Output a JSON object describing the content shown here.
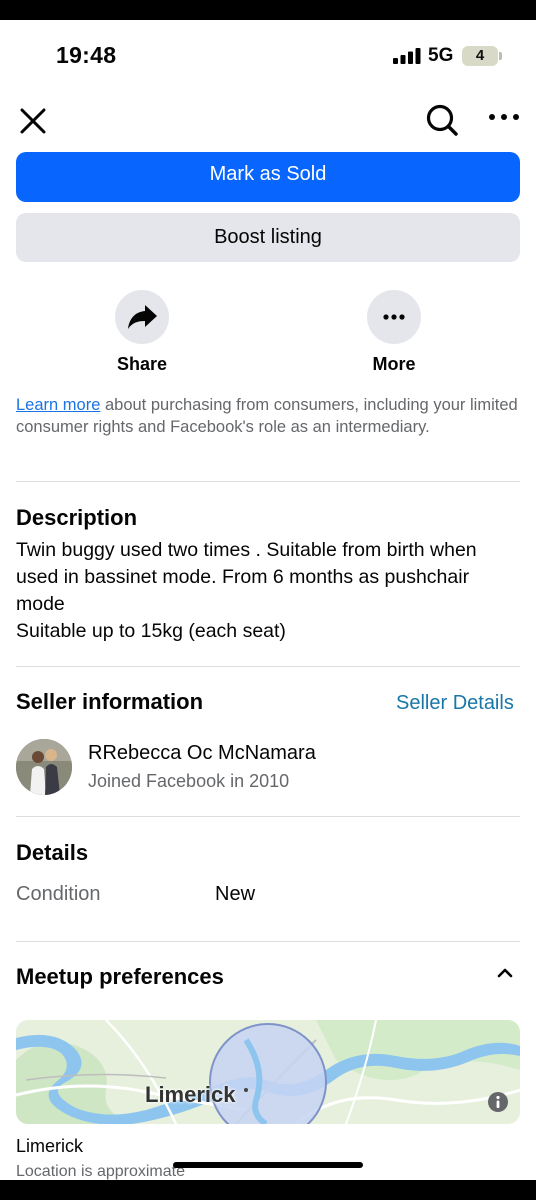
{
  "status_bar": {
    "time": "19:48",
    "network": "5G",
    "battery": "4"
  },
  "nav": {
    "close_icon": "close-icon",
    "search_icon": "search-icon",
    "more_icon": "more-horizontal-icon"
  },
  "actions": {
    "mark_sold": "Mark as Sold",
    "boost": "Boost listing",
    "share": "Share",
    "more": "More"
  },
  "legal": {
    "link": "Learn more",
    "text": " about purchasing from consumers, including your limited consumer rights and Facebook's role as an intermediary."
  },
  "description": {
    "heading": "Description",
    "body": "Twin buggy used two times . Suitable from birth when used in bassinet mode. From 6 months as pushchair mode\nSuitable up to 15kg (each seat)"
  },
  "seller": {
    "heading": "Seller information",
    "details_link": "Seller Details",
    "name": "RRebecca Oc McNamara",
    "joined": "Joined Facebook in 2010"
  },
  "details": {
    "heading": "Details",
    "condition_label": "Condition",
    "condition_value": "New"
  },
  "meetup": {
    "heading": "Meetup preferences",
    "map_label": "Limerick",
    "location": "Limerick",
    "note": "Location is approximate"
  },
  "colors": {
    "primary": "#0866ff",
    "secondary_bg": "#e4e6eb",
    "link": "#1877a8",
    "muted": "#65676b"
  }
}
